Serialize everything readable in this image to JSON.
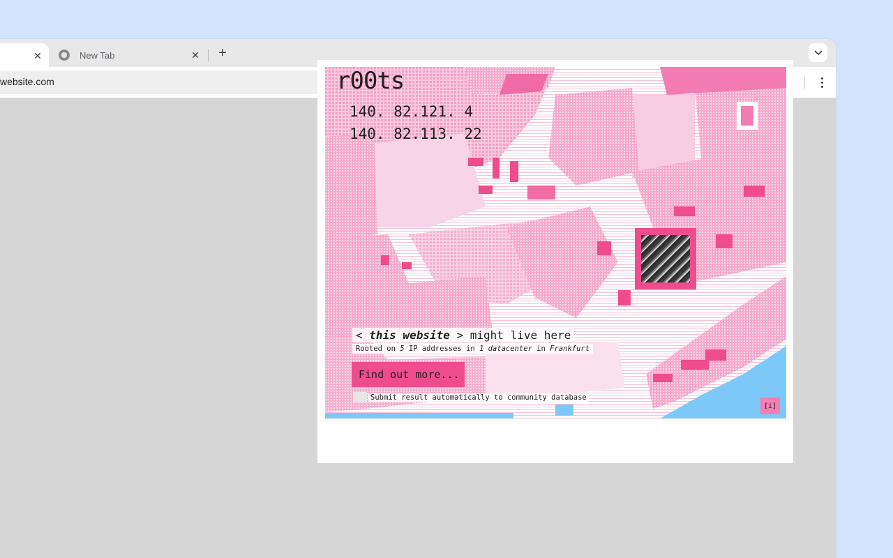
{
  "browser": {
    "tabs": [
      {
        "label": "",
        "active": true
      },
      {
        "label": "New Tab",
        "active": false
      }
    ],
    "url": "website.com",
    "accent": "#ef4c8e"
  },
  "popup": {
    "brand": "r00ts",
    "ip_addresses": [
      "140. 82.121. 4",
      "140. 82.113. 22"
    ],
    "tagline_prefix": "< ",
    "tagline_em": "this website",
    "tagline_suffix": " > might live here",
    "sub_a": "Rooted on ",
    "sub_count": "5",
    "sub_b": " IP addresses in ",
    "sub_dc": "1 datacenter",
    "sub_c": " in ",
    "sub_city": "Frankfurt",
    "cta_label": "Find out more...",
    "checkbox_label": "Submit result automatically to community database",
    "info_label": "[i]",
    "colors": {
      "pink": "#ef4c8e",
      "light_pink": "#f7a6cb",
      "water": "#7cc8f8"
    }
  }
}
